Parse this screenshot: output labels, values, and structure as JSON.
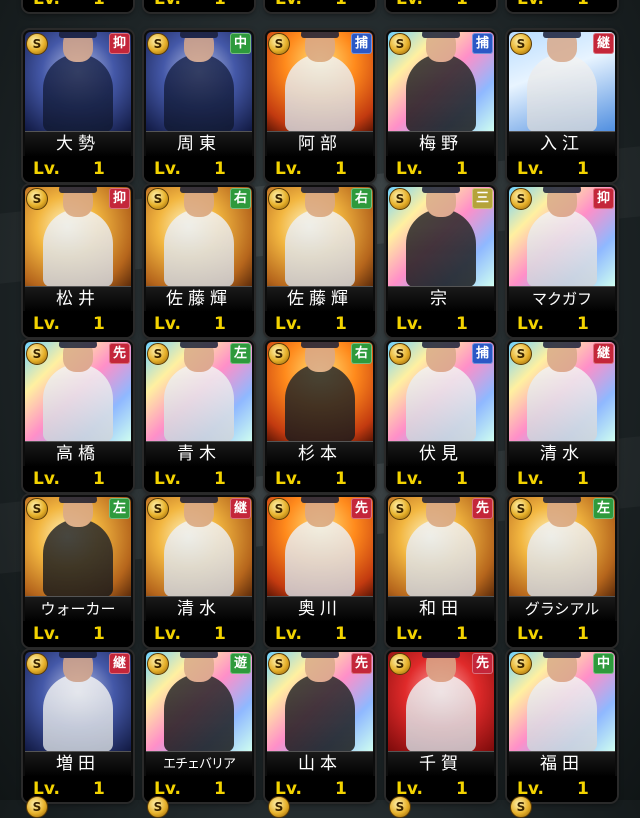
{
  "coin_symbol": "S",
  "level_label": "Lv.",
  "top_partial_levels": [
    "1",
    "1",
    "1",
    "1",
    "1"
  ],
  "cards": [
    {
      "name": "大勢",
      "position": "抑",
      "level": "1",
      "bg": "dark",
      "fig": "navy"
    },
    {
      "name": "周東",
      "position": "中",
      "level": "1",
      "bg": "dark",
      "fig": "navy"
    },
    {
      "name": "阿部",
      "position": "捕",
      "level": "1",
      "bg": "fire",
      "fig": "light"
    },
    {
      "name": "梅野",
      "position": "捕",
      "level": "1",
      "bg": "prism",
      "fig": "dark"
    },
    {
      "name": "入江",
      "position": "継",
      "level": "1",
      "bg": "sky",
      "fig": "light"
    },
    {
      "name": "松井",
      "position": "抑",
      "level": "1",
      "bg": "gold",
      "fig": "light"
    },
    {
      "name": "佐藤輝",
      "position": "右",
      "level": "1",
      "bg": "gold",
      "fig": "light"
    },
    {
      "name": "佐藤輝",
      "position": "右",
      "level": "1",
      "bg": "gold",
      "fig": "light"
    },
    {
      "name": "宗",
      "position": "三",
      "level": "1",
      "bg": "prism",
      "fig": "dark"
    },
    {
      "name": "マクガフ",
      "position": "抑",
      "level": "1",
      "bg": "prism",
      "fig": "light"
    },
    {
      "name": "高橋",
      "position": "先",
      "level": "1",
      "bg": "prism",
      "fig": "light"
    },
    {
      "name": "青木",
      "position": "左",
      "level": "1",
      "bg": "prism",
      "fig": "light"
    },
    {
      "name": "杉本",
      "position": "右",
      "level": "1",
      "bg": "fire",
      "fig": "dark"
    },
    {
      "name": "伏見",
      "position": "捕",
      "level": "1",
      "bg": "prism",
      "fig": "light"
    },
    {
      "name": "清水",
      "position": "継",
      "level": "1",
      "bg": "prism",
      "fig": "light"
    },
    {
      "name": "ウォーカー",
      "position": "左",
      "level": "1",
      "bg": "gold",
      "fig": "dark"
    },
    {
      "name": "清水",
      "position": "継",
      "level": "1",
      "bg": "gold",
      "fig": "light"
    },
    {
      "name": "奥川",
      "position": "先",
      "level": "1",
      "bg": "fire",
      "fig": "light"
    },
    {
      "name": "和田",
      "position": "先",
      "level": "1",
      "bg": "gold",
      "fig": "light"
    },
    {
      "name": "グラシアル",
      "position": "左",
      "level": "1",
      "bg": "gold",
      "fig": "light"
    },
    {
      "name": "増田",
      "position": "継",
      "level": "1",
      "bg": "dark",
      "fig": "light"
    },
    {
      "name": "エチェバリア",
      "position": "遊",
      "level": "1",
      "bg": "prism",
      "fig": "dark"
    },
    {
      "name": "山本",
      "position": "先",
      "level": "1",
      "bg": "prism",
      "fig": "dark"
    },
    {
      "name": "千賀",
      "position": "先",
      "level": "1",
      "bg": "red",
      "fig": "light"
    },
    {
      "name": "福田",
      "position": "中",
      "level": "1",
      "bg": "prism",
      "fig": "light"
    }
  ],
  "position_colors": {
    "抑": "#c4263a",
    "中": "#2e9a3c",
    "捕": "#2b58c6",
    "継": "#c4263a",
    "右": "#2e9a3c",
    "三": "#b5a33a",
    "先": "#c4263a",
    "左": "#2e9a3c",
    "遊": "#2e9a3c"
  }
}
